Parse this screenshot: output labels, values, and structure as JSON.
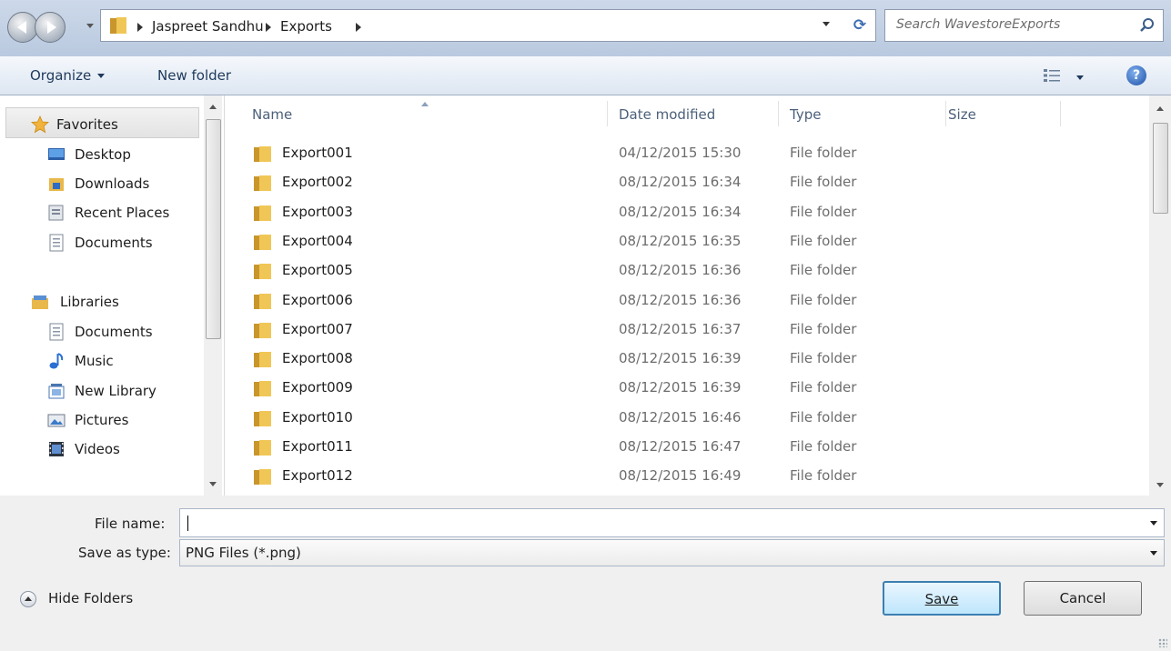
{
  "address_bar": {
    "breadcrumbs": [
      "Jaspreet Sandhu",
      "Exports"
    ],
    "search_placeholder": "Search WavestoreExports"
  },
  "toolbar": {
    "organize_label": "Organize",
    "new_folder_label": "New folder"
  },
  "nav_pane": {
    "favorites": {
      "label": "Favorites",
      "items": [
        {
          "label": "Desktop",
          "icon": "desktop-icon"
        },
        {
          "label": "Downloads",
          "icon": "downloads-icon"
        },
        {
          "label": "Recent Places",
          "icon": "recent-places-icon"
        },
        {
          "label": "Documents",
          "icon": "documents-icon"
        }
      ]
    },
    "libraries": {
      "label": "Libraries",
      "items": [
        {
          "label": "Documents",
          "icon": "documents-icon"
        },
        {
          "label": "Music",
          "icon": "music-icon"
        },
        {
          "label": "New Library",
          "icon": "library-icon"
        },
        {
          "label": "Pictures",
          "icon": "pictures-icon"
        },
        {
          "label": "Videos",
          "icon": "videos-icon"
        }
      ]
    }
  },
  "file_list": {
    "columns": [
      "Name",
      "Date modified",
      "Type",
      "Size"
    ],
    "rows": [
      {
        "name": "Export001",
        "date": "04/12/2015 15:30",
        "type": "File folder"
      },
      {
        "name": "Export002",
        "date": "08/12/2015 16:34",
        "type": "File folder"
      },
      {
        "name": "Export003",
        "date": "08/12/2015 16:34",
        "type": "File folder"
      },
      {
        "name": "Export004",
        "date": "08/12/2015 16:35",
        "type": "File folder"
      },
      {
        "name": "Export005",
        "date": "08/12/2015 16:36",
        "type": "File folder"
      },
      {
        "name": "Export006",
        "date": "08/12/2015 16:36",
        "type": "File folder"
      },
      {
        "name": "Export007",
        "date": "08/12/2015 16:37",
        "type": "File folder"
      },
      {
        "name": "Export008",
        "date": "08/12/2015 16:39",
        "type": "File folder"
      },
      {
        "name": "Export009",
        "date": "08/12/2015 16:39",
        "type": "File folder"
      },
      {
        "name": "Export010",
        "date": "08/12/2015 16:46",
        "type": "File folder"
      },
      {
        "name": "Export011",
        "date": "08/12/2015 16:47",
        "type": "File folder"
      },
      {
        "name": "Export012",
        "date": "08/12/2015 16:49",
        "type": "File folder"
      }
    ]
  },
  "form": {
    "file_name_label": "File name:",
    "file_name_value": "",
    "save_as_type_label": "Save as type:",
    "save_as_type_value": "PNG Files (*.png)"
  },
  "footer": {
    "hide_folders_label": "Hide Folders",
    "save_label": "Save",
    "cancel_label": "Cancel"
  },
  "colors": {
    "accent": "#3c7fb1",
    "folder": "#e8b84a"
  }
}
